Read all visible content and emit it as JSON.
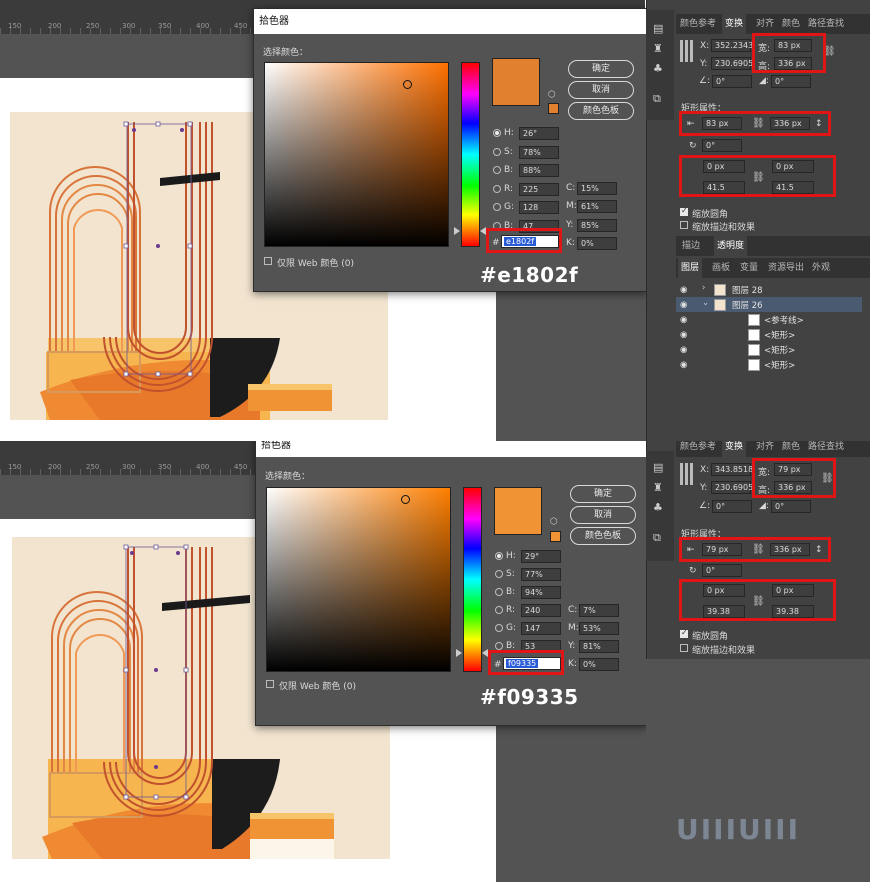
{
  "panels": [
    {
      "ruler_ticks": [
        "150",
        "200",
        "250",
        "300",
        "350",
        "400",
        "450"
      ],
      "dialog": {
        "title": "拾色器",
        "select_color_label": "选择颜色：",
        "buttons": {
          "ok": "确定",
          "cancel": "取消",
          "swatches": "颜色色板"
        },
        "fields": {
          "H": "26°",
          "S": "78%",
          "B": "88%",
          "R": "225",
          "G": "128",
          "B2": "47",
          "C": "15%",
          "M": "61%",
          "Y": "85%",
          "K": "0%"
        },
        "hex": "e1802f",
        "web_only_label": "仅限 Web 颜色 (0)",
        "color": "#e1802f"
      },
      "caption": "#e1802f",
      "panel": {
        "tabs": [
          "颜色参考",
          "变换",
          "对齐",
          "颜色",
          "路径查找"
        ],
        "x_label": "X:",
        "x_value": "352.2343",
        "y_label": "Y:",
        "y_value": "230.6905",
        "w_label": "宽:",
        "w_value": "83 px",
        "h_label": "高:",
        "h_value": "336 px",
        "angle1": "0°",
        "angle2": "0°",
        "rect_props": "矩形属性：",
        "rect_w": "83 px",
        "rect_h": "336 px",
        "rot": "0°",
        "corner_tl": "0 px",
        "corner_tr": "0 px",
        "corner_bl": "41.5",
        "corner_br": "41.5",
        "scale_corners": "缩放圆角",
        "scale_strokes": "缩放描边和效果",
        "stroke_tab": "描边",
        "opacity_tab": "透明度",
        "layer_tabs": [
          "图层",
          "画板",
          "变量",
          "资源导出",
          "外观"
        ],
        "layers": [
          {
            "name": "图层 28"
          },
          {
            "name": "图层 26"
          },
          {
            "name": "<参考线>"
          },
          {
            "name": "<矩形>"
          },
          {
            "name": "<矩形>"
          },
          {
            "name": "<矩形>"
          }
        ]
      }
    },
    {
      "ruler_ticks": [
        "150",
        "200",
        "250",
        "300",
        "350",
        "400",
        "450"
      ],
      "dialog": {
        "title": "拾色器",
        "select_color_label": "选择颜色：",
        "buttons": {
          "ok": "确定",
          "cancel": "取消",
          "swatches": "颜色色板"
        },
        "fields": {
          "H": "29°",
          "S": "77%",
          "B": "94%",
          "R": "240",
          "G": "147",
          "B2": "53",
          "C": "7%",
          "M": "53%",
          "Y": "81%",
          "K": "0%"
        },
        "hex": "f09335",
        "web_only_label": "仅限 Web 颜色 (0)",
        "color": "#f09335"
      },
      "caption": "#f09335",
      "panel": {
        "tabs": [
          "颜色参考",
          "变换",
          "对齐",
          "颜色",
          "路径查找"
        ],
        "x_label": "X:",
        "x_value": "343.8518",
        "y_label": "Y:",
        "y_value": "230.6905",
        "w_label": "宽:",
        "w_value": "79 px",
        "h_label": "高:",
        "h_value": "336 px",
        "angle1": "0°",
        "angle2": "0°",
        "rect_props": "矩形属性：",
        "rect_w": "79 px",
        "rect_h": "336 px",
        "rot": "0°",
        "corner_tl": "0 px",
        "corner_tr": "0 px",
        "corner_bl": "39.38",
        "corner_br": "39.38",
        "scale_corners": "缩放圆角",
        "scale_strokes": "缩放描边和效果"
      }
    }
  ],
  "watermark": "UIIIUIII",
  "colors": {
    "accent_red": "#e01616",
    "artboard": "#f2e4cf",
    "orange": "#f09335"
  }
}
